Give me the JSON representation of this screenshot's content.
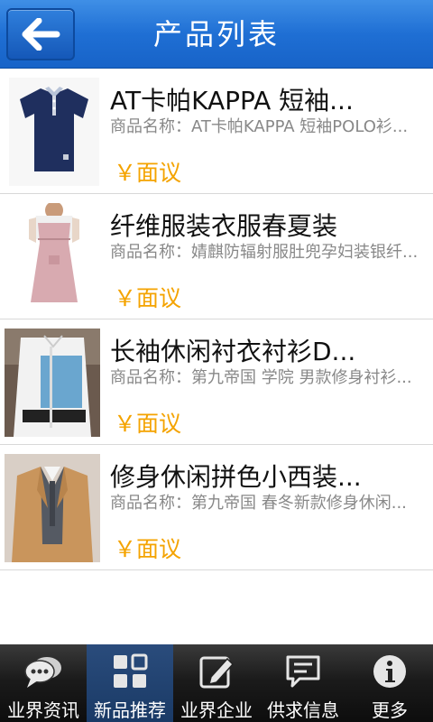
{
  "header": {
    "title": "产品列表",
    "back_icon": "arrow-left-icon"
  },
  "products": [
    {
      "title": "AT卡帕KAPPA 短袖...",
      "desc": "商品名称：AT卡帕KAPPA 短袖POLO衫...",
      "price": "￥面议",
      "image": "navy-polo-shirt"
    },
    {
      "title": "纤维服装衣服春夏装",
      "desc": "商品名称：婧麒防辐射服肚兜孕妇装银纤...",
      "price": "￥面议",
      "image": "pink-maternity-dress"
    },
    {
      "title": "长袖休闲衬衣衬衫D...",
      "desc": "商品名称：第九帝国 学院 男款修身衬衫...",
      "price": "￥面议",
      "image": "white-blue-shirt"
    },
    {
      "title": "修身休闲拼色小西装...",
      "desc": "商品名称：第九帝国 春冬新款修身休闲...",
      "price": "￥面议",
      "image": "tan-blazer"
    }
  ],
  "tabs": [
    {
      "label": "业界资讯",
      "icon": "chat-bubbles-icon",
      "active": false
    },
    {
      "label": "新品推荐",
      "icon": "grid-icon",
      "active": true
    },
    {
      "label": "业界企业",
      "icon": "edit-note-icon",
      "active": false
    },
    {
      "label": "供求信息",
      "icon": "message-icon",
      "active": false
    },
    {
      "label": "更多",
      "icon": "info-icon",
      "active": false
    }
  ],
  "colors": {
    "header_blue": "#1f6fd4",
    "price_orange": "#f4a300",
    "tab_active": "#1a3a66"
  }
}
